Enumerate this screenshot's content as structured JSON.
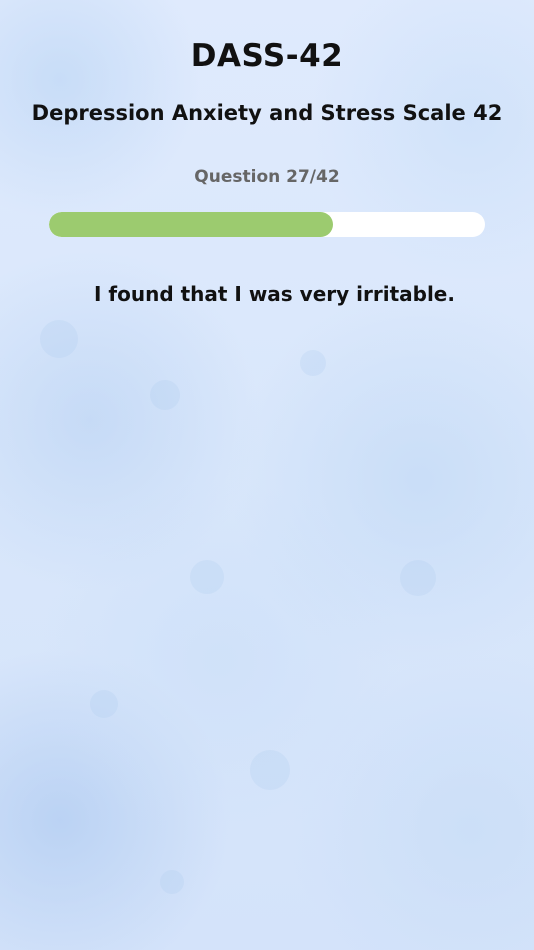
{
  "header": {
    "title": "DASS-42",
    "subtitle": "Depression Anxiety and Stress Scale 42"
  },
  "progress": {
    "label": "Question 27/42",
    "current": 27,
    "total": 42,
    "fraction": 0.652
  },
  "question": {
    "text": "I found that I was very irritable."
  },
  "colors": {
    "progress_fill": "#9ccb6f",
    "progress_track": "#ffffff",
    "background": "#dbe8fc",
    "title_text": "#111111",
    "counter_text": "#666666"
  }
}
